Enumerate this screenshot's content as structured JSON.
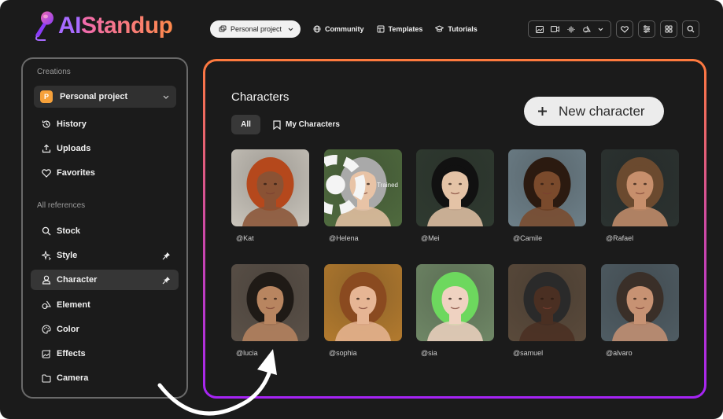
{
  "brand": {
    "name_part1": "AI",
    "name_part2": "Standup"
  },
  "topnav": {
    "project_select": "Personal project",
    "links": [
      "Community",
      "Templates",
      "Tutorials"
    ]
  },
  "sidebar": {
    "creations_heading": "Creations",
    "project": {
      "badge": "P",
      "label": "Personal project"
    },
    "creation_items": [
      {
        "label": "History",
        "icon": "history-icon"
      },
      {
        "label": "Uploads",
        "icon": "upload-icon"
      },
      {
        "label": "Favorites",
        "icon": "heart-icon"
      }
    ],
    "references_heading": "All references",
    "reference_items": [
      {
        "label": "Stock",
        "icon": "search-icon",
        "pinned": false
      },
      {
        "label": "Style",
        "icon": "sparkles-icon",
        "pinned": true
      },
      {
        "label": "Character",
        "icon": "person-icon",
        "pinned": true,
        "active": true
      },
      {
        "label": "Element",
        "icon": "shapes-icon",
        "pinned": false
      },
      {
        "label": "Color",
        "icon": "palette-icon",
        "pinned": false
      },
      {
        "label": "Effects",
        "icon": "image-effects-icon",
        "pinned": false
      },
      {
        "label": "Camera",
        "icon": "folder-icon",
        "pinned": false
      }
    ]
  },
  "main": {
    "title": "Characters",
    "filters": {
      "all": "All",
      "mine": "My Characters"
    },
    "new_button": "New character",
    "characters": [
      {
        "handle": "@Kat",
        "bg": "#c9c4bb",
        "skin": "#8a5234",
        "hair": "#b5481c"
      },
      {
        "handle": "@Helena",
        "bg": "#4f6a3e",
        "skin": "#e8c3a6",
        "hair": "#a9a9a9",
        "badge": "Trained"
      },
      {
        "handle": "@Mei",
        "bg": "#2f3a30",
        "skin": "#e4c3a6",
        "hair": "#111111"
      },
      {
        "handle": "@Camile",
        "bg": "#6d7f88",
        "skin": "#7a4a2c",
        "hair": "#2b1a10"
      },
      {
        "handle": "@Rafael",
        "bg": "#2b3230",
        "skin": "#c78f6c",
        "hair": "#6b4a2f"
      },
      {
        "handle": "@lucia",
        "bg": "#5b5148",
        "skin": "#b88560",
        "hair": "#1f1a16"
      },
      {
        "handle": "@sophia",
        "bg": "#b27a2e",
        "skin": "#e6b594",
        "hair": "#8a4a20"
      },
      {
        "handle": "@sia",
        "bg": "#6f8766",
        "skin": "#efd2c1",
        "hair": "#6dd85e"
      },
      {
        "handle": "@samuel",
        "bg": "#5a4a3b",
        "skin": "#4a2f22",
        "hair": "#2a2a2a"
      },
      {
        "handle": "@alvaro",
        "bg": "#4f5c63",
        "skin": "#c79273",
        "hair": "#3a2f28"
      }
    ]
  }
}
